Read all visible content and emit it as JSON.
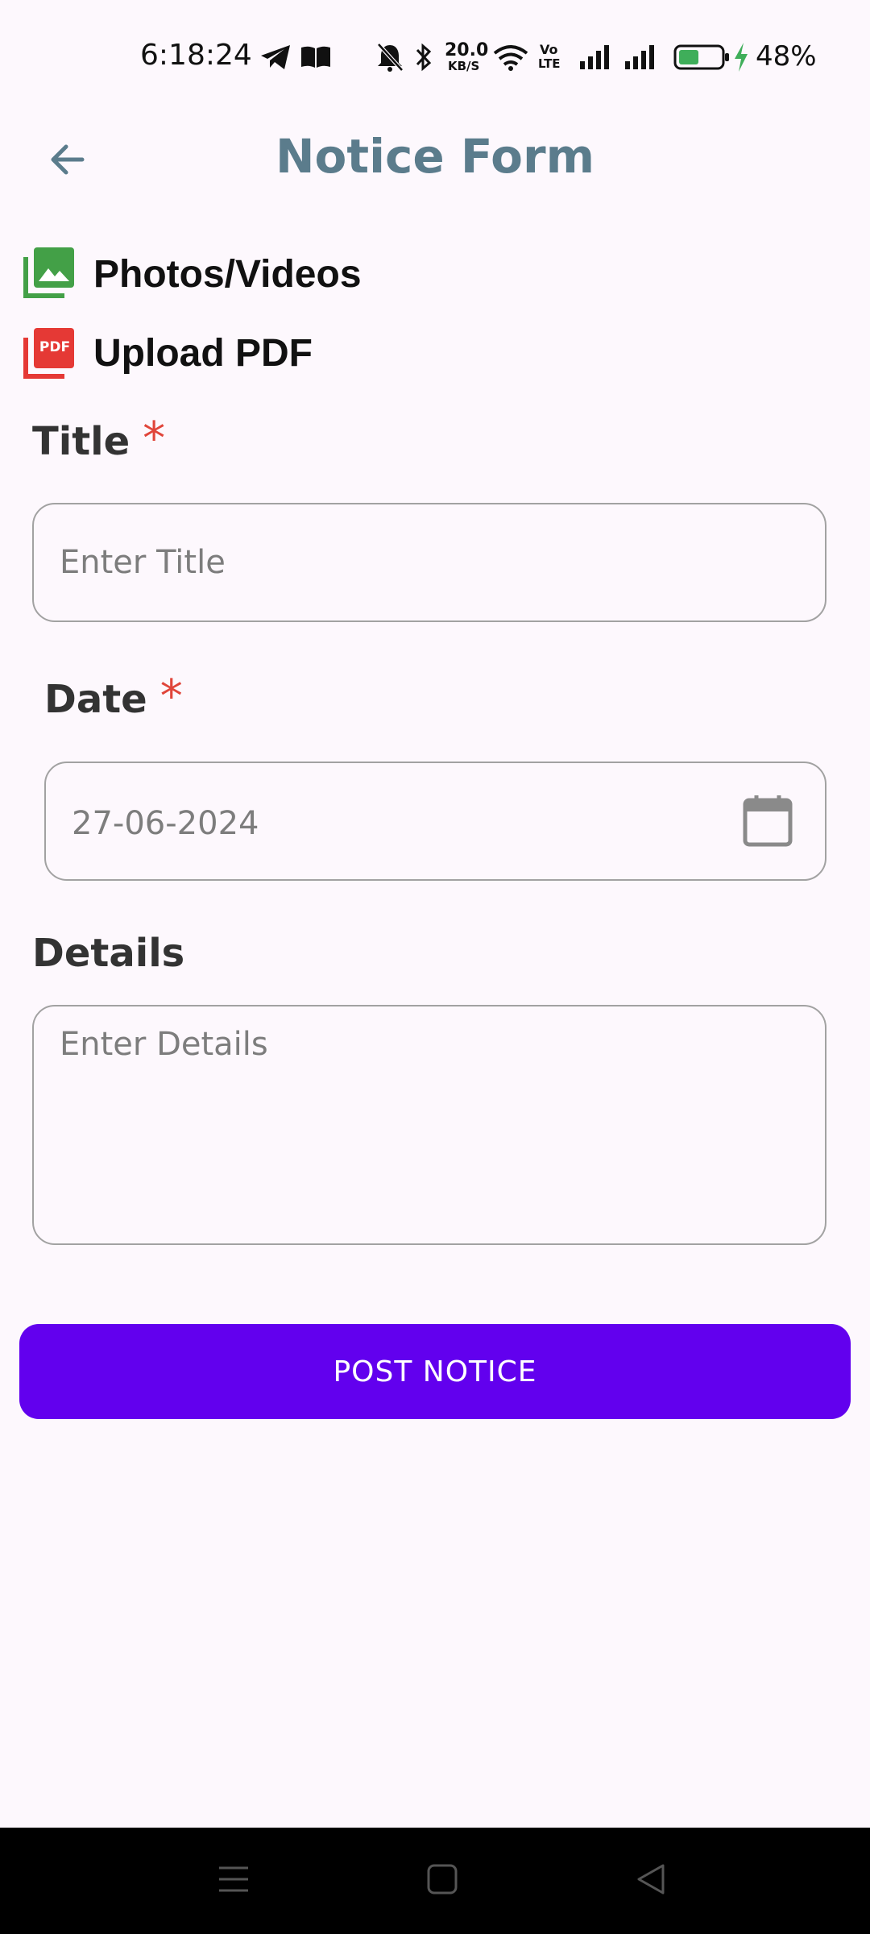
{
  "status_bar": {
    "time": "6:18:24",
    "net_speed_top": "20.0",
    "net_speed_bottom": "KB/S",
    "volte_top": "Vo",
    "volte_bottom": "LTE",
    "battery_percent": "48%",
    "battery_level": 0.48
  },
  "header": {
    "title": "Notice Form"
  },
  "attachments": {
    "photos_label": "Photos/Videos",
    "pdf_label": "Upload PDF",
    "pdf_icon_text": "PDF"
  },
  "form": {
    "title_label": "Title",
    "title_placeholder": "Enter Title",
    "date_label": "Date",
    "date_value": "27-06-2024",
    "details_label": "Details",
    "details_placeholder": "Enter Details",
    "required_mark": "*"
  },
  "actions": {
    "post_label": "POST NOTICE"
  },
  "colors": {
    "accent": "#6200ee",
    "title": "#5b7c8c",
    "required": "#e0453a",
    "photo_icon": "#43a047",
    "pdf_icon": "#e53935"
  }
}
